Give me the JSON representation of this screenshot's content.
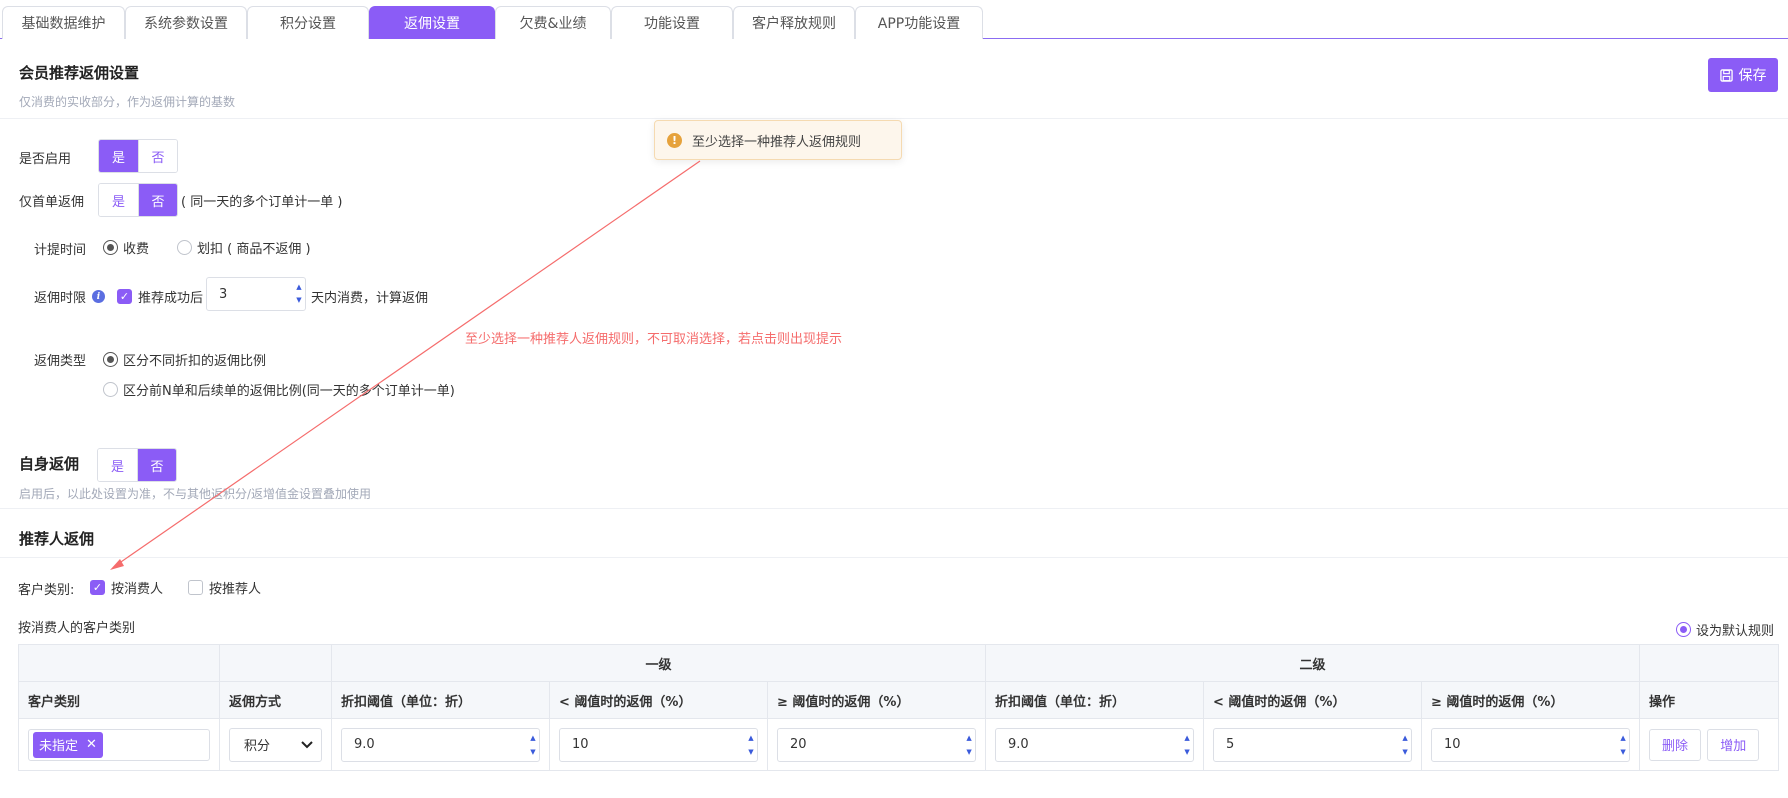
{
  "tabs": [
    "基础数据维护",
    "系统参数设置",
    "积分设置",
    "返佣设置",
    "欠费&业绩",
    "功能设置",
    "客户释放规则",
    "APP功能设置"
  ],
  "active_tab": "返佣设置",
  "member_section": {
    "title": "会员推荐返佣设置",
    "subtitle": "仅消费的实收部分，作为返佣计算的基数",
    "save_label": "保存"
  },
  "toast": {
    "text": "至少选择一种推荐人返佣规则"
  },
  "annotation": "至少选择一种推荐人返佣规则，不可取消选择，若点击则出现提示",
  "yes_label": "是",
  "no_label": "否",
  "enabled": {
    "label": "是否启用",
    "selected": "是"
  },
  "first_order": {
    "label": "仅首单返佣",
    "selected": "否",
    "hint": "( 同一天的多个订单计一单 )"
  },
  "accrual_time": {
    "label": "计提时间",
    "options": [
      "收费",
      "划扣 ( 商品不返佣 )"
    ],
    "selected": "收费"
  },
  "limit": {
    "label": "返佣时限",
    "checkbox_label": "推荐成功后",
    "checked": true,
    "days": "3",
    "suffix": "天内消费，计算返佣"
  },
  "rebate_type": {
    "label": "返佣类型",
    "options": [
      "区分不同折扣的返佣比例",
      "区分前N单和后续单的返佣比例(同一天的多个订单计一单)"
    ],
    "selected": "区分不同折扣的返佣比例"
  },
  "self_rebate": {
    "title": "自身返佣",
    "selected": "否",
    "subtitle": "启用后，以此处设置为准，不与其他返积分/返增值金设置叠加使用"
  },
  "referrer": {
    "title": "推荐人返佣",
    "category_label": "客户类别:",
    "options": [
      {
        "label": "按消费人",
        "checked": true
      },
      {
        "label": "按推荐人",
        "checked": false
      }
    ],
    "sub_title": "按消费人的客户类别",
    "default_rule_label": "设为默认规则"
  },
  "table": {
    "group_headers": [
      "一级",
      "二级"
    ],
    "columns": [
      "客户类别",
      "返佣方式",
      "折扣阈值（单位：折）",
      "< 阈值时的返佣（%）",
      "≥ 阈值时的返佣（%）",
      "折扣阈值（单位：折）",
      "< 阈值时的返佣（%）",
      "≥ 阈值时的返佣（%）",
      "操作"
    ],
    "row": {
      "tag": "未指定",
      "method": "积分",
      "l1_threshold": "9.0",
      "l1_below": "10",
      "l1_above": "20",
      "l2_threshold": "9.0",
      "l2_below": "5",
      "l2_above": "10",
      "delete_label": "删除",
      "add_label": "增加"
    }
  },
  "colors": {
    "accent": "#8b5cf6",
    "warning": "#e6a23c",
    "annotation": "#f56c6c"
  }
}
